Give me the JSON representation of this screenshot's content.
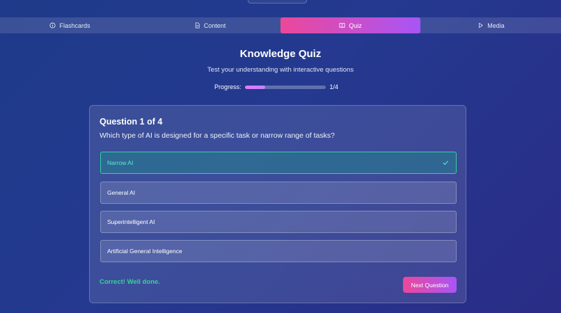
{
  "nav": {
    "tabs": [
      {
        "label": "Flashcards",
        "icon": "info-circle-icon",
        "active": false
      },
      {
        "label": "Content",
        "icon": "document-icon",
        "active": false
      },
      {
        "label": "Quiz",
        "icon": "book-open-icon",
        "active": true
      },
      {
        "label": "Media",
        "icon": "play-icon",
        "active": false
      }
    ]
  },
  "header": {
    "title": "Knowledge Quiz",
    "subtitle": "Test your understanding with interactive questions"
  },
  "progress": {
    "label": "Progress:",
    "counter": "1/4",
    "fraction": 0.25
  },
  "question": {
    "title": "Question 1 of 4",
    "text": "Which type of AI is designed for a specific task or narrow range of tasks?",
    "options": [
      {
        "label": "Narrow AI",
        "state": "correct"
      },
      {
        "label": "General AI",
        "state": "default"
      },
      {
        "label": "Superintelligent AI",
        "state": "default"
      },
      {
        "label": "Artificial General Intelligence",
        "state": "default"
      }
    ],
    "feedback": "Correct! Well done.",
    "next_label": "Next Question"
  },
  "colors": {
    "accent_gradient_start": "#ec4899",
    "accent_gradient_end": "#a855f7",
    "correct_text": "#34d399",
    "correct_border": "#2dd4a0",
    "background": "#24398f"
  }
}
